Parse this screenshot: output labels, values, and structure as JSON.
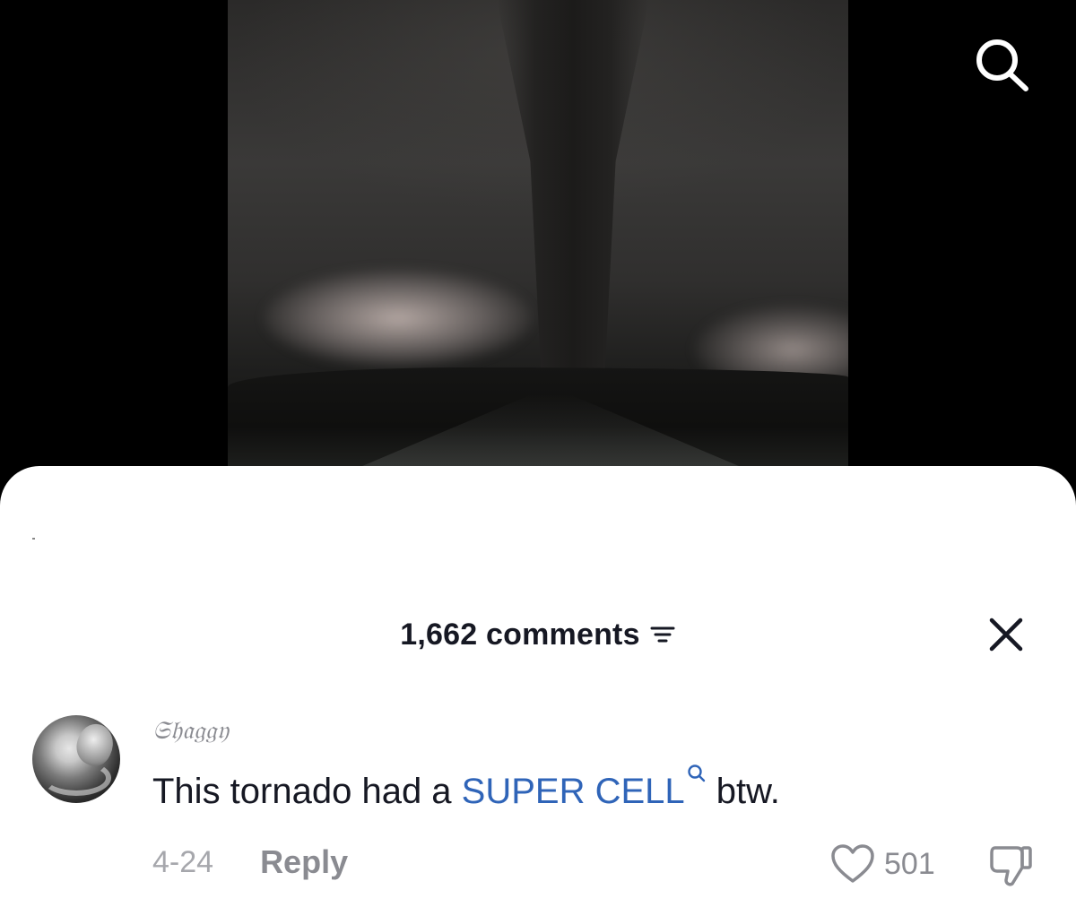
{
  "video": {
    "search_icon": "search-icon"
  },
  "comments_panel": {
    "count_label": "1,662 comments",
    "filter_icon": "sort-lines-icon",
    "close_icon": "close-icon",
    "comments": [
      {
        "username": "𝔖𝔥𝔞𝔤𝔤𝔶",
        "text_before": "This tornado had a ",
        "link_text": "SUPER CELL",
        "link_icon": "search-icon",
        "text_after": " btw.",
        "date": "4-24",
        "reply_label": "Reply",
        "likes": "501",
        "like_icon": "heart-icon",
        "dislike_icon": "thumbs-down-icon"
      }
    ]
  },
  "colors": {
    "link": "#2f64b8",
    "primary_text": "#161823",
    "secondary_text": "#8a8b91"
  }
}
